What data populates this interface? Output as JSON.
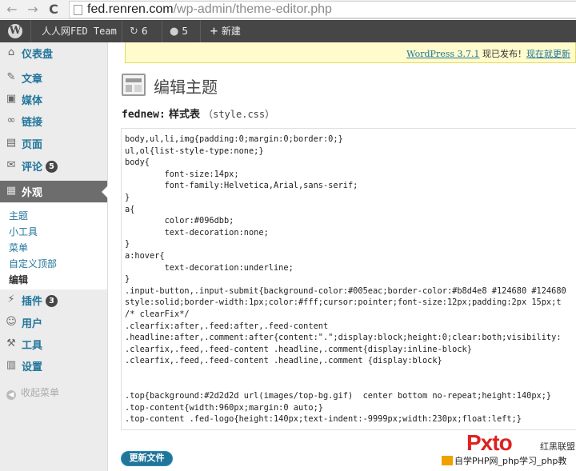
{
  "browser": {
    "url_host": "fed.renren.com",
    "url_path": "/wp-admin/theme-editor.php",
    "back_glyph": "←",
    "forward_glyph": "→",
    "reload_glyph": "C"
  },
  "adminbar": {
    "logo_icon": "wordpress-logo-icon",
    "site_name": "人人网FED Team",
    "updates_count": "6",
    "comments_count": "5",
    "new_label": "新建"
  },
  "sidebar": {
    "items": [
      {
        "label": "仪表盘",
        "icon": "dashboard-icon"
      },
      {
        "label": "文章",
        "icon": "pin-icon"
      },
      {
        "label": "媒体",
        "icon": "media-icon"
      },
      {
        "label": "链接",
        "icon": "link-icon"
      },
      {
        "label": "页面",
        "icon": "page-icon"
      },
      {
        "label": "评论",
        "icon": "comment-icon",
        "badge": "5"
      },
      {
        "label": "外观",
        "icon": "appearance-icon"
      },
      {
        "label": "插件",
        "icon": "plugin-icon",
        "badge": "3"
      },
      {
        "label": "用户",
        "icon": "users-icon"
      },
      {
        "label": "工具",
        "icon": "tools-icon"
      },
      {
        "label": "设置",
        "icon": "settings-icon"
      }
    ],
    "submenu": [
      "主题",
      "小工具",
      "菜单",
      "自定义顶部",
      "编辑"
    ],
    "collapse_label": "收起菜单"
  },
  "notice": {
    "version_link": "WordPress 3.7.1",
    "middle_text": " 现已发布！",
    "update_link": "现在就更新"
  },
  "page": {
    "title": "编辑主题",
    "theme_name": "fednew:",
    "heading_label": "样式表",
    "file_name": "（style.css）"
  },
  "editor": {
    "lines": [
      "body,ul,li,img{padding:0;margin:0;border:0;}",
      "ul,ol{list-style-type:none;}",
      "body{",
      "        font-size:14px;",
      "        font-family:Helvetica,Arial,sans-serif;",
      "}",
      "a{",
      "        color:#096dbb;",
      "        text-decoration:none;",
      "}",
      "a:hover{",
      "        text-decoration:underline;",
      "}",
      ".input-button,.input-submit{background-color:#005eac;border-color:#b8d4e8 #124680 #124680",
      "style:solid;border-width:1px;color:#fff;cursor:pointer;font-size:12px;padding:2px 15px;t",
      "/* clearFix*/",
      ".clearfix:after,.feed:after,.feed-content",
      ".headline:after,.comment:after{content:\".\";display:block;height:0;clear:both;visibility:",
      ".clearfix,.feed,.feed-content .headline,.comment{display:inline-block}",
      ".clearfix,.feed,.feed-content .headline,.comment {display:block}",
      "",
      "",
      ".top{background:#2d2d2d url(images/top-bg.gif)  center bottom no-repeat;height:140px;}",
      ".top-content{width:960px;margin:0 auto;}",
      ".top-content .fed-logo{height:140px;text-indent:-9999px;width:230px;float:left;}"
    ]
  },
  "update_button": "更新文件",
  "watermark": {
    "logo_text": "Pxto",
    "logo_side": "红黑联盟",
    "bottom_text": "自学PHP网_php学习_php教"
  }
}
